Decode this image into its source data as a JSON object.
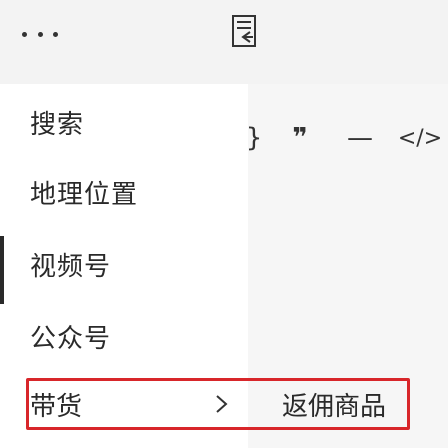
{
  "menu": {
    "items": [
      {
        "label": "搜索"
      },
      {
        "label": "地理位置"
      },
      {
        "label": "视频号"
      },
      {
        "label": "公众号"
      }
    ],
    "highlighted": {
      "label": "带货",
      "submenu_label": "返佣商品"
    }
  },
  "toolbar": {
    "bracket_glyph": "}",
    "quote_glyph": "❞",
    "divider_glyph": "—",
    "code_glyph": "</>"
  },
  "icons": {
    "more": "more-horizontal-icon",
    "document": "document-insert-icon",
    "chevron": "chevron-right-icon"
  },
  "colors": {
    "highlight_border": "#d8262a"
  }
}
